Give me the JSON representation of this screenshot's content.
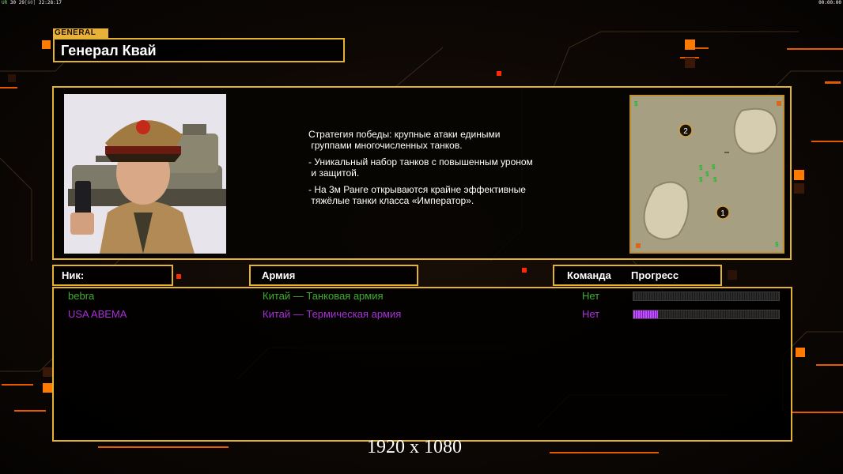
{
  "status_bar": {
    "ur_label": "UR",
    "fps": "30",
    "fps_sub": "29",
    "fps_max": "[60]",
    "clock": "22:28:17",
    "game_timer": "00:00:00"
  },
  "general": {
    "tag": "GENERAL",
    "name": "Генерал Квай",
    "description": [
      "Стратегия победы: крупные атаки едиными\n группами многочисленных танков.",
      "- Уникальный набор танков с повышенным уроном\n и защитой.",
      "- На 3м Ранге открываются крайне эффективные\n тяжёлые танки класса «Император»."
    ]
  },
  "minimap": {
    "start_positions": [
      "1",
      "2"
    ],
    "supply_symbol": "$"
  },
  "table": {
    "headers": {
      "nick": "Ник:",
      "army": "Армия",
      "team": "Команда",
      "progress": "Прогресс"
    },
    "players": [
      {
        "nick": "bebra",
        "army": "Китай — Танковая армия",
        "team": "Нет",
        "progress": 0,
        "color": "#3fae2f"
      },
      {
        "nick": "USA ABEMA",
        "army": "Китай — Термическая армия",
        "team": "Нет",
        "progress": 0.17,
        "color": "#a930d8"
      }
    ]
  },
  "resolution_label": "1920 x 1080",
  "colors": {
    "accent": "#e3b22e",
    "orange_square": "#ff6a00",
    "red_square": "#ff2a00"
  }
}
